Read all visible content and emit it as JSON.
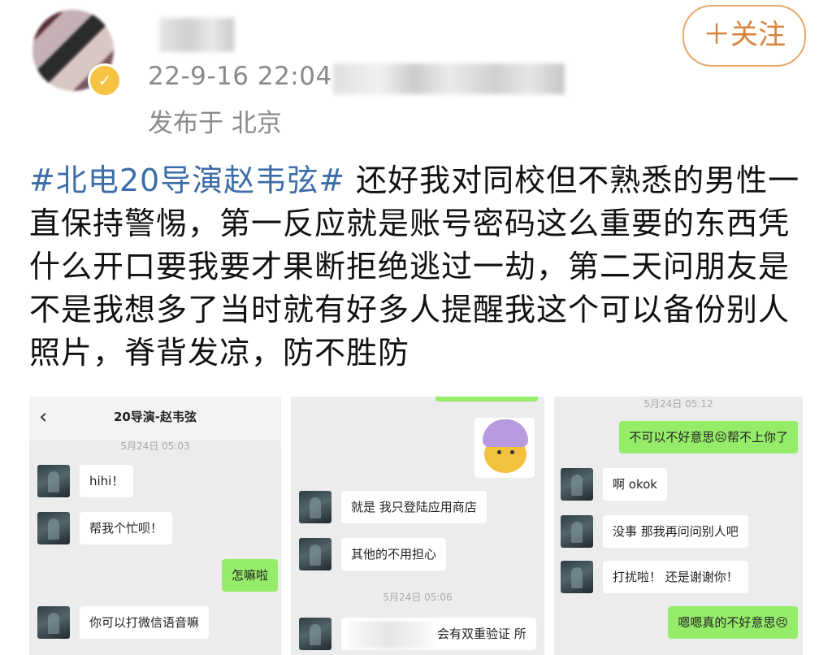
{
  "header": {
    "post_time": "22-9-16 22:04",
    "location": "发布于 北京",
    "follow_label": "＋关注"
  },
  "post": {
    "hashtag": "#北电20导演赵韦弦#",
    "text": " 还好我对同校但不熟悉的男性一直保持警惕，第一反应就是账号密码这么重要的东西凭什么开口要我要才果断拒绝逃过一劫，第二天问朋友是不是我想多了当时就有好多人提醒我这个可以备份别人照片，脊背发凉，防不胜防"
  },
  "screenshots": {
    "shot1": {
      "title": "20导演-赵韦弦",
      "timestamp": "5月24日 05:03",
      "messages": [
        {
          "side": "them",
          "text": "hihi！"
        },
        {
          "side": "them",
          "text": "帮我个忙呗！"
        },
        {
          "side": "me",
          "text": "怎嘛啦"
        },
        {
          "side": "them",
          "text": "你可以打微信语音嘛"
        }
      ]
    },
    "shot2": {
      "messages": [
        {
          "side": "them",
          "text": "就是 我只登陆应用商店"
        },
        {
          "side": "them",
          "text": "其他的不用担心"
        }
      ],
      "timestamp": "5月24日 05:06",
      "partial_message": "会有双重验证 所"
    },
    "shot3": {
      "timestamp": "5月24日 05:12",
      "messages": [
        {
          "side": "me",
          "text": "不可以不好意思😣帮不上你了"
        },
        {
          "side": "them",
          "text": "啊 okok"
        },
        {
          "side": "them",
          "text": "没事 那我再问问别人吧"
        },
        {
          "side": "them",
          "text": "打扰啦！ 还是谢谢你！"
        },
        {
          "side": "me",
          "text": "嗯嗯真的不好意思😣"
        }
      ]
    }
  },
  "colors": {
    "hashtag": "#3d6da8",
    "follow_border": "#e8a86a",
    "bubble_me": "#95ec69",
    "meta_gray": "#8a8a8a"
  }
}
